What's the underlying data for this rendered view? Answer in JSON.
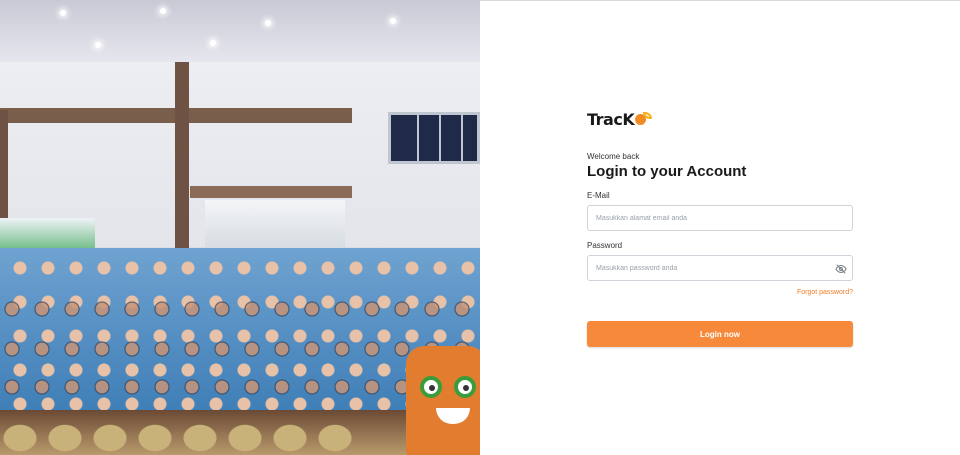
{
  "logo": {
    "text": "TracK",
    "icon": "tracko-logo-icon",
    "brand_color": "#f28b24"
  },
  "login": {
    "welcome": "Welcome back",
    "title": "Login to your Account",
    "email": {
      "label": "E-Mail",
      "placeholder": "Masukkan alamat email anda",
      "value": ""
    },
    "password": {
      "label": "Password",
      "placeholder": "Masukkan password anda",
      "value": "",
      "toggle_icon": "eye-off-icon"
    },
    "forgot_label": "Forgot password?",
    "submit_label": "Login now"
  },
  "colors": {
    "accent": "#f7893a",
    "link": "#f07f2a",
    "border": "#cfd4da"
  },
  "hero_image": {
    "icon": "event-crowd-photo"
  }
}
